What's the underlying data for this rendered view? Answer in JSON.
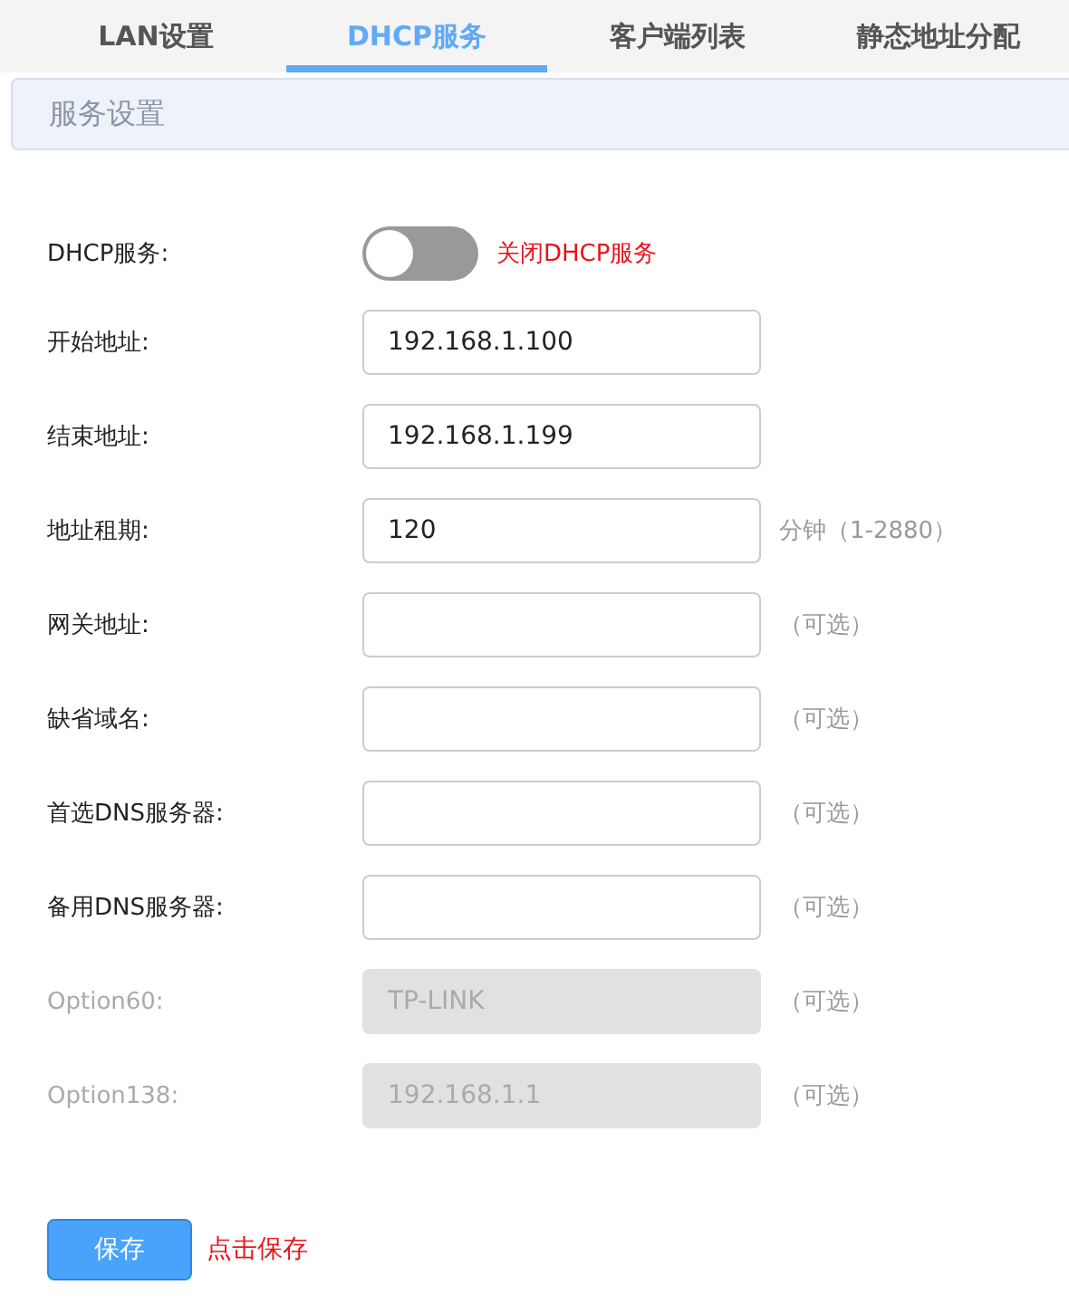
{
  "tabs": [
    {
      "label": "LAN设置",
      "selected": false
    },
    {
      "label": "DHCP服务",
      "selected": true
    },
    {
      "label": "客户端列表",
      "selected": false
    },
    {
      "label": "静态地址分配",
      "selected": false
    }
  ],
  "section": {
    "title": "服务设置"
  },
  "fields": [
    {
      "kind": "toggle",
      "label": "DHCP服务:",
      "on": false,
      "note": "关闭DHCP服务"
    },
    {
      "kind": "input",
      "label": "开始地址:",
      "value": "192.168.1.100",
      "disabled": false
    },
    {
      "kind": "input",
      "label": "结束地址:",
      "value": "192.168.1.199",
      "disabled": false
    },
    {
      "kind": "input",
      "label": "地址租期:",
      "value": "120",
      "disabled": false,
      "hint": "分钟（1-2880）"
    },
    {
      "kind": "input",
      "label": "网关地址:",
      "disabled": false,
      "hint": "（可选）"
    },
    {
      "kind": "input",
      "label": "缺省域名:",
      "disabled": false,
      "hint": "（可选）"
    },
    {
      "kind": "input",
      "label": "首选DNS服务器:",
      "disabled": false,
      "hint": "（可选）"
    },
    {
      "kind": "input",
      "label": "备用DNS服务器:",
      "disabled": false,
      "hint": "（可选）"
    },
    {
      "kind": "input",
      "label": "Option60:",
      "value": "TP-LINK",
      "disabled": true,
      "hint": "（可选）"
    },
    {
      "kind": "input",
      "label": "Option138:",
      "value": "192.168.1.1",
      "disabled": true,
      "hint": "（可选）"
    }
  ],
  "save": {
    "label": "保存",
    "note": "点击保存"
  }
}
